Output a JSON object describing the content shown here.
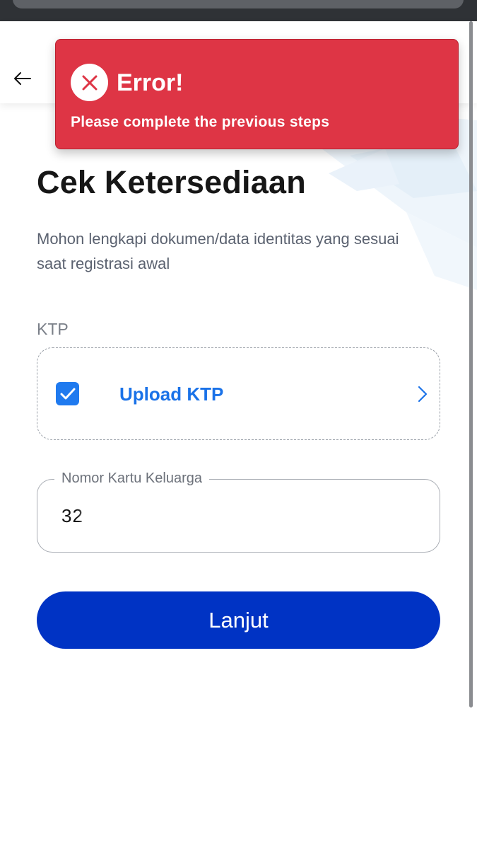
{
  "header": {
    "back_icon": "arrow-left-icon"
  },
  "toast": {
    "icon": "close-circle-icon",
    "title": "Error!",
    "message": "Please complete the previous steps",
    "color": "#de3545"
  },
  "page": {
    "title": "Cek Ketersediaan",
    "description": "Mohon lengkapi dokumen/data identitas yang sesuai saat registrasi awal"
  },
  "ktp": {
    "section_label": "KTP",
    "upload_label": "Upload KTP",
    "checked": true,
    "check_icon": "checkbox-checked-icon",
    "chevron_icon": "chevron-right-icon"
  },
  "kk_field": {
    "label": "Nomor Kartu Keluarga",
    "visible_value": "32"
  },
  "submit": {
    "label": "Lanjut",
    "color": "#0033c4"
  },
  "colors": {
    "accent": "#1f7aef",
    "link": "#1a72e8"
  }
}
